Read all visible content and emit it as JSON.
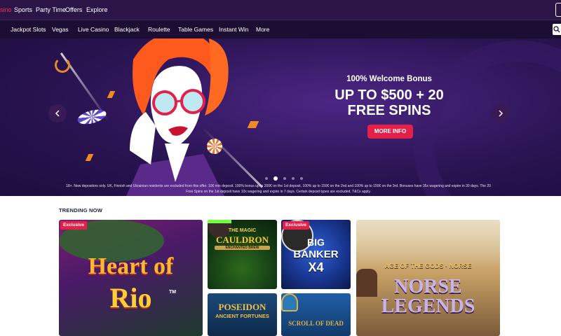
{
  "topnav": {
    "items": [
      {
        "label": "sino",
        "active": true
      },
      {
        "label": "Sports",
        "active": false
      },
      {
        "label": "Party Time",
        "active": false
      },
      {
        "label": "Offers",
        "active": false
      },
      {
        "label": "Explore",
        "active": false
      }
    ]
  },
  "subnav": {
    "items": [
      "Jackpot Slots",
      "Vegas",
      "Live Casino",
      "Blackjack",
      "Roulette",
      "Table Games",
      "Instant Win",
      "More"
    ]
  },
  "hero": {
    "subtitle": "100% Welcome Bonus",
    "title_line1": "UP TO $500 + 20",
    "title_line2": "FREE SPINS",
    "cta": "MORE INFO",
    "slides_total": 5,
    "active_slide": 2,
    "terms": "18+. New depositors only. UK, Finnish and Ukrainian residents are excluded from this offer. 10€ min deposit. 100% bonus up to 200€ on the 1st deposit, 100% up to 150€ on the 2nd and 100% up to 150€ on the 3rd. Bonuses have 35x wagering and expire in 30 days. The 20 Free Spins on the 1st deposit have 10x wagering and expire in 7 days. Certain deposit types are excluded. T&Cs apply."
  },
  "trending": {
    "heading": "TRENDING NOW",
    "badge": "Exclusive",
    "games": {
      "heart_of_rio": {
        "line1": "Heart of",
        "line2": "Rio",
        "tm": "TM",
        "exclusive": true
      },
      "magic_cauldron": {
        "line1": "THE MAGIC",
        "line2": "CAULDRON",
        "line3": "ENCHANTED BREW",
        "exclusive": false
      },
      "big_banker": {
        "line1": "BIG",
        "line2": "BANKER",
        "line3": "X4",
        "exclusive": true
      },
      "age_of_gods": {
        "line1": "AGE OF THE GODS · NORSE",
        "line2": "NORSE",
        "line3": "LEGENDS",
        "exclusive": false
      },
      "poseidon": {
        "line1": "POSEIDON",
        "line2": "ANCIENT FORTUNES",
        "exclusive": false
      },
      "scroll_of_dead": {
        "line1": "SCROLL OF DEAD",
        "exclusive": false
      }
    }
  },
  "colors": {
    "topnav_bg": "#2b1446",
    "subnav_bg": "#1c0e33",
    "accent": "#e3204a",
    "hero_bg": "#2a1452"
  },
  "icons": {
    "search": "search-icon",
    "prev": "chevron-left-icon",
    "next": "chevron-right-icon"
  }
}
